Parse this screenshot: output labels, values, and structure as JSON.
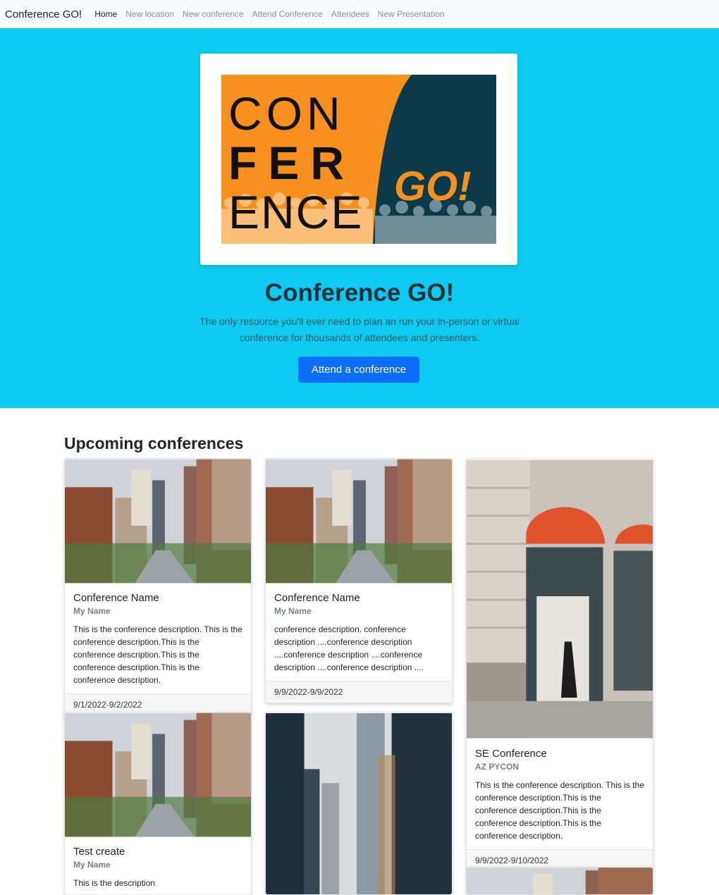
{
  "navbar": {
    "brand": "Conference GO!",
    "links": [
      "Home",
      "New location",
      "New conference",
      "Attend Conference",
      "Attendees",
      "New Presentation"
    ]
  },
  "hero": {
    "logo_text": {
      "line1": "CON",
      "line2": "FER",
      "line3": "ENCE",
      "go": "GO!"
    },
    "title": "Conference GO!",
    "lead": "The only resource you'll ever need to plan an run your in-person or virtual conference for thousands of attendees and presenters.",
    "button": "Attend a conference"
  },
  "upcoming": {
    "title": "Upcoming conferences",
    "cards": [
      {
        "title": "Conference Name",
        "subtitle": "My Name",
        "text": "This is the conference description. This is the conference description.This is the conference description.This is the conference description.This is the conference description.",
        "dates": "9/1/2022-9/2/2022"
      },
      {
        "title": "Conference Name",
        "subtitle": "My Name",
        "text": "conference description. conference description ....conference description ....conference description ....conference description ....conference description ....",
        "dates": "9/9/2022-9/9/2022"
      },
      {
        "title": "SE Conference",
        "subtitle": "AZ PYCON",
        "text": "This is the conference description. This is the conference description.This is the conference description.This is the conference description.This is the conference description.",
        "dates": "9/9/2022-9/10/2022"
      },
      {
        "title": "Test create",
        "subtitle": "My Name",
        "text": "This is the description"
      }
    ]
  },
  "colors": {
    "hero_bg": "#0dcaf0",
    "logo_orange": "#f7901e",
    "logo_navy": "#0c3a48",
    "primary": "#0d6efd"
  }
}
